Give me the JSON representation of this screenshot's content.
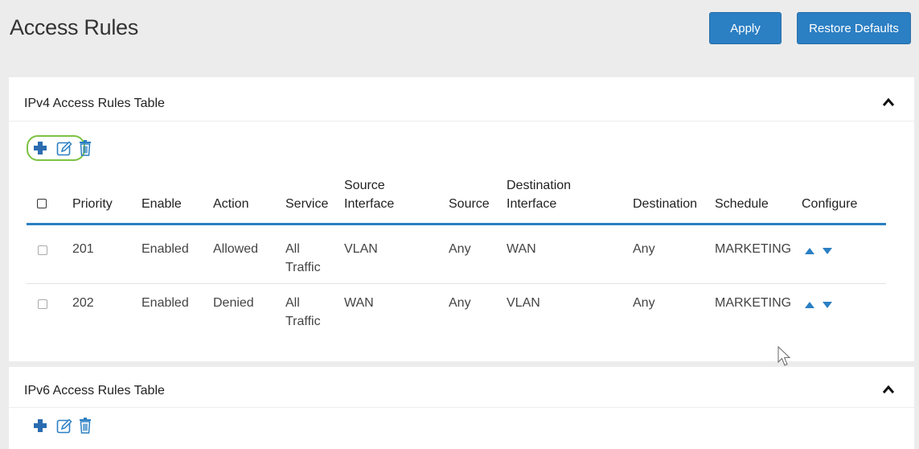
{
  "header": {
    "title": "Access Rules",
    "apply_label": "Apply",
    "restore_label": "Restore Defaults"
  },
  "ipv4": {
    "title": "IPv4 Access Rules Table",
    "toolbar": {
      "add_icon": "plus-icon",
      "edit_icon": "edit-icon",
      "delete_icon": "trash-icon"
    },
    "columns": {
      "priority": "Priority",
      "enable": "Enable",
      "action": "Action",
      "service": "Service",
      "source_interface_1": "Source",
      "source_interface_2": "Interface",
      "source": "Source",
      "destination_interface_1": "Destination",
      "destination_interface_2": "Interface",
      "destination": "Destination",
      "schedule": "Schedule",
      "configure": "Configure"
    },
    "rows": [
      {
        "priority": "201",
        "enable": "Enabled",
        "action": "Allowed",
        "service_1": "All",
        "service_2": "Traffic",
        "source_interface": "VLAN",
        "source": "Any",
        "destination_interface": "WAN",
        "destination": "Any",
        "schedule": "MARKETING"
      },
      {
        "priority": "202",
        "enable": "Enabled",
        "action": "Denied",
        "service_1": "All",
        "service_2": "Traffic",
        "source_interface": "WAN",
        "source": "Any",
        "destination_interface": "VLAN",
        "destination": "Any",
        "schedule": "MARKETING"
      }
    ]
  },
  "ipv6": {
    "title": "IPv6 Access Rules Table",
    "toolbar": {
      "add_icon": "plus-icon",
      "edit_icon": "edit-icon",
      "delete_icon": "trash-icon"
    }
  },
  "colors": {
    "accent": "#2b7fc3",
    "highlight": "#7cc242",
    "background": "#ececec",
    "panel": "#ffffff"
  }
}
